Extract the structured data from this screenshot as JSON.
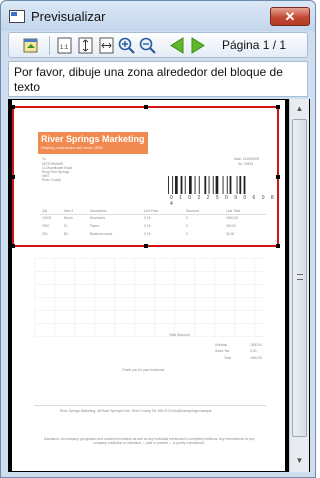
{
  "window": {
    "title": "Previsualizar",
    "close_label": "✕"
  },
  "toolbar": {
    "page_label": "Página 1 / 1",
    "buttons": [
      {
        "name": "open-icon"
      },
      {
        "name": "actual-size-icon"
      },
      {
        "name": "fit-height-icon"
      },
      {
        "name": "fit-width-icon"
      },
      {
        "name": "zoom-in-icon"
      },
      {
        "name": "zoom-out-icon"
      },
      {
        "name": "previous-page-icon"
      },
      {
        "name": "next-page-icon"
      }
    ]
  },
  "message": "Por favor, dibuje una zona alrededor del bloque de texto",
  "colors": {
    "selection": "#d41313",
    "logo": "#f08a50",
    "nav_arrows": "#5fb82b"
  },
  "document": {
    "logo_name": "River Springs Marketing",
    "logo_tagline": "Helping companies sell since 1998",
    "to_label": "To:",
    "address_lines": [
      "MOTHIRAMIR",
      "11 Moonflower Road",
      "Rosy Pine Springs",
      "4567",
      "River County"
    ],
    "date_line": "Date: 11/25/2009",
    "invoice_line": "No: 25615",
    "barcode_digits": "0 1 0 2 2 5 0 9 0 6 0 8 4",
    "table": {
      "headers": [
        "Qty",
        "Item #",
        "Description",
        "Unit Price",
        "Discount",
        "Line Total"
      ],
      "rows": [
        [
          "10000",
          "Broch",
          "Brochures",
          "0.15",
          "0",
          "1500.00"
        ],
        [
          "2000",
          "FL",
          "Flyers",
          "0.15",
          "0",
          "300.00"
        ],
        [
          "200",
          "BC",
          "Business cards",
          "0.15",
          "0",
          "30.00"
        ]
      ]
    },
    "total_discount_label": "Total Discount",
    "subtotal_label": "Subtotal",
    "subtotal_value": "1830.00",
    "sales_tax_label": "Sales Tax",
    "sales_tax_value": "0.00",
    "total_label": "Total",
    "total_value": "1830.00",
    "thank_you": "Thank you for your business!",
    "footer": "River Springs Marketing, 48 Rose Springs Drive, River County  Tel: 555 0123  info@riversprings.example",
    "disclaimer": "Disclaimer: All company, geographic and contact information as well as any individual mentioned is completely fictitious. Any resemblance to any company, institution or individual — past or present — is purely coincidental."
  }
}
